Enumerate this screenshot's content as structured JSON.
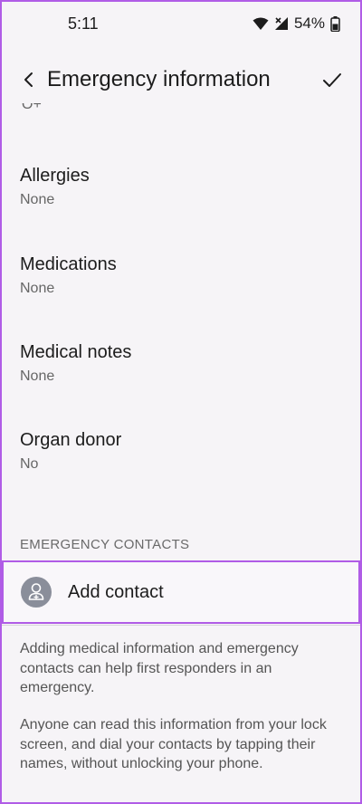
{
  "status_bar": {
    "time": "5:11",
    "battery_percent": "54%"
  },
  "app_bar": {
    "title": "Emergency information"
  },
  "clipped_value": "O+",
  "medical_items": [
    {
      "title": "Allergies",
      "value": "None"
    },
    {
      "title": "Medications",
      "value": "None"
    },
    {
      "title": "Medical notes",
      "value": "None"
    },
    {
      "title": "Organ donor",
      "value": "No"
    }
  ],
  "emergency_contacts": {
    "header": "EMERGENCY CONTACTS",
    "add_contact_label": "Add contact"
  },
  "footer": {
    "info_1": "Adding medical information and emergency contacts can help first responders in an emergency.",
    "info_2": "Anyone can read this information from your lock screen, and dial your contacts by tapping their names, without unlocking your phone."
  },
  "colors": {
    "accent_border": "#b05ce6",
    "background": "#f6f4f7",
    "avatar": "#8a8e9a"
  }
}
